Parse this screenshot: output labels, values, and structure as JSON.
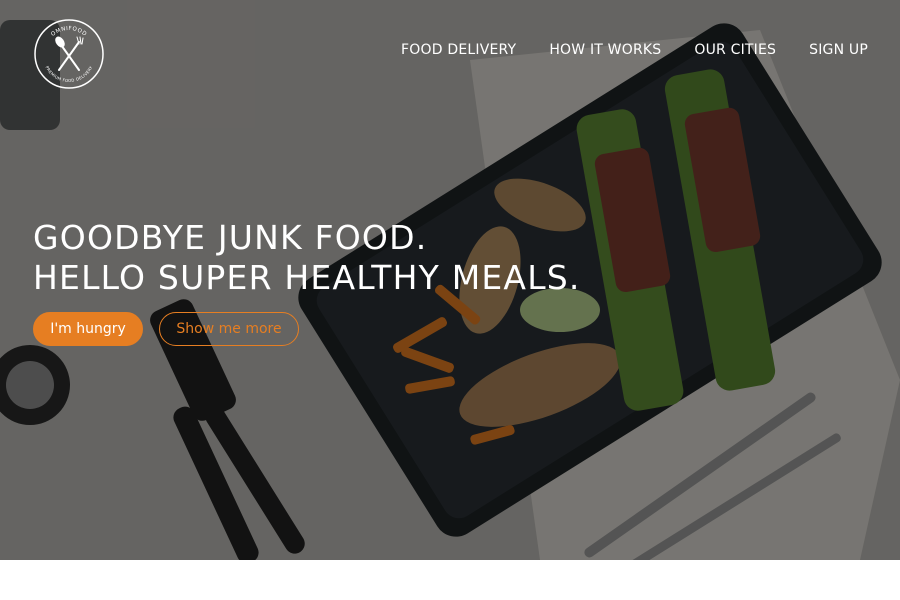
{
  "logo": {
    "top_text": "OMNIFOOD",
    "bottom_text": "PREMIUM FOOD DELIVERY",
    "icon": "fork-and-spoon-icon"
  },
  "nav": {
    "items": [
      {
        "label": "FOOD DELIVERY"
      },
      {
        "label": "HOW IT WORKS"
      },
      {
        "label": "OUR CITIES"
      },
      {
        "label": "SIGN UP"
      }
    ]
  },
  "hero": {
    "headline_line1": "GOODBYE JUNK FOOD.",
    "headline_line2": "HELLO SUPER HEALTHY MEALS.",
    "primary_button": "I'm hungry",
    "secondary_button": "Show me more"
  },
  "colors": {
    "accent": "#e67e22",
    "text_on_dark": "#ffffff",
    "overlay": "rgba(0,0,0,0.45)"
  }
}
